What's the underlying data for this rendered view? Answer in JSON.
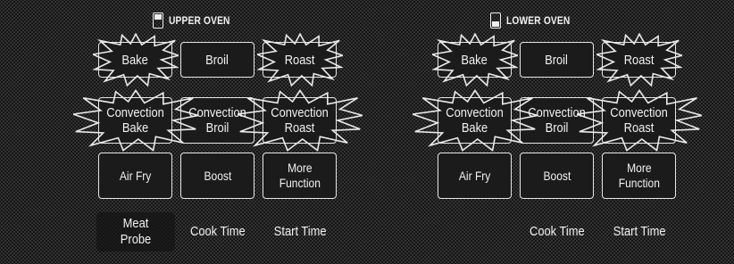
{
  "upper_oven": {
    "title": "UPPER OVEN",
    "buttons": [
      "Bake",
      "Broil",
      "Roast",
      "Convection\nBake",
      "Convection\nBroil",
      "Convection\nRoast",
      "Air Fry",
      "Boost",
      "More\nFunction"
    ],
    "bottom": [
      "Meat\nProbe",
      "Cook Time",
      "Start Time"
    ]
  },
  "lower_oven": {
    "title": "LOWER OVEN",
    "buttons": [
      "Bake",
      "Broil",
      "Roast",
      "Convection\nBake",
      "Convection\nBroil",
      "Convection\nRoast",
      "Air Fry",
      "Boost",
      "More\nFunction"
    ],
    "bottom": [
      "Cook Time",
      "Start Time"
    ]
  },
  "colors": {
    "background": "#151515",
    "outline": "#e8e8e8",
    "text": "#f2f2f2"
  },
  "icons": [
    "upper-oven-icon",
    "lower-oven-icon",
    "starburst-icon"
  ]
}
